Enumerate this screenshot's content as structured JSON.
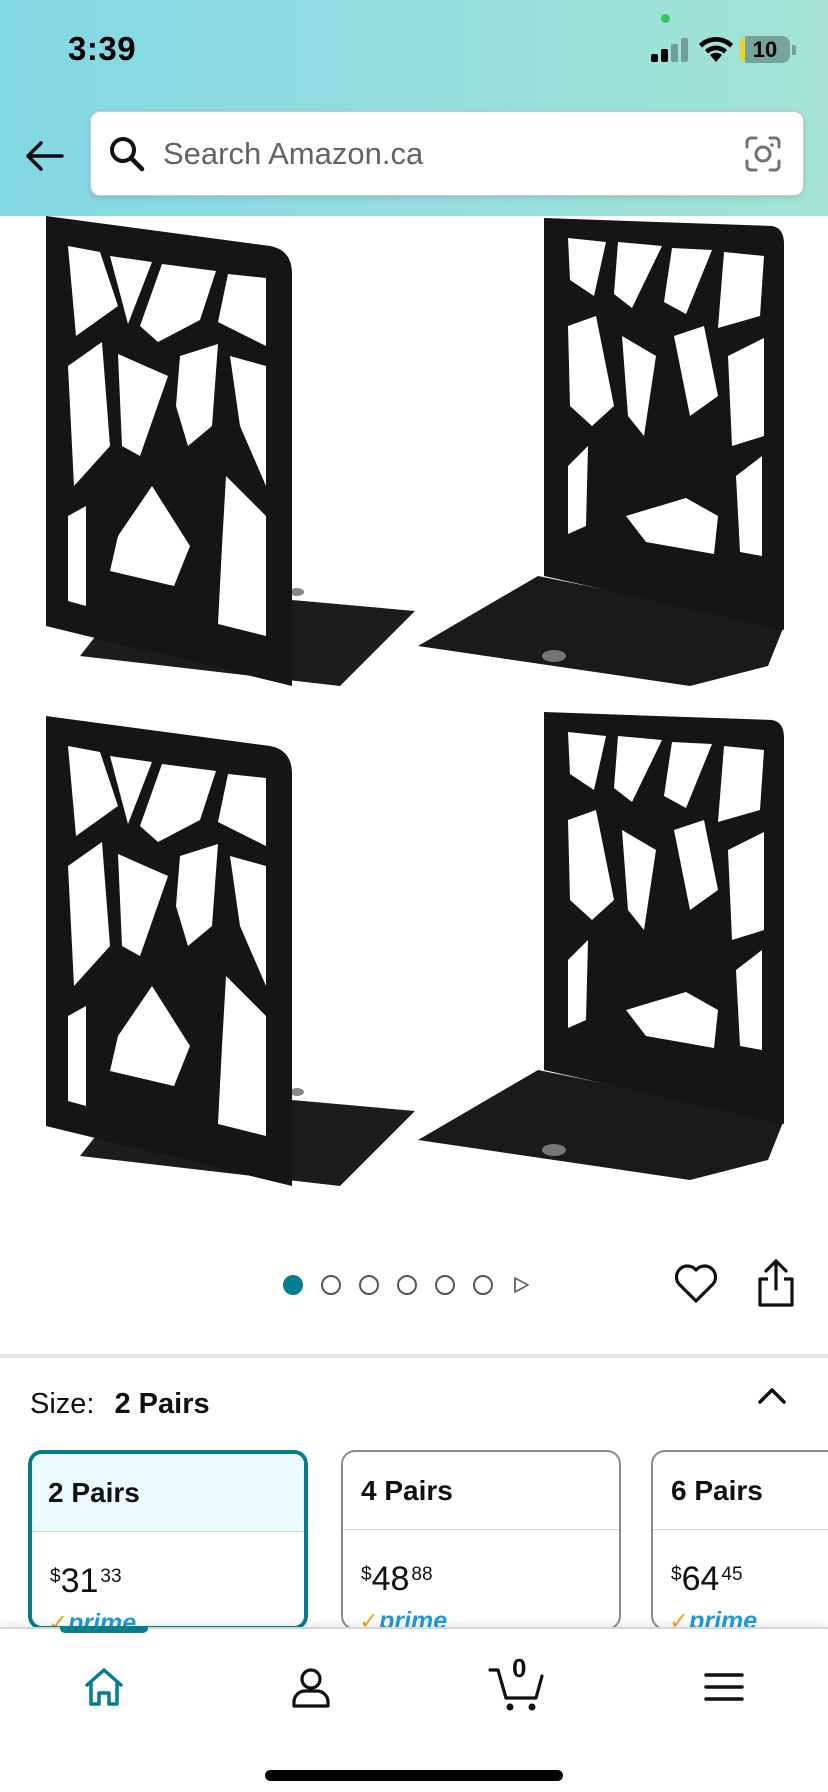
{
  "status_bar": {
    "time": "3:39",
    "battery": "10",
    "battery_level": 0.1
  },
  "search": {
    "placeholder": "Search Amazon.ca"
  },
  "gallery": {
    "image_count": 6,
    "current_index": 1,
    "icons": [
      "back-arrow-icon",
      "search-icon",
      "camera-lens-icon",
      "heart-icon",
      "share-icon",
      "play-next-icon"
    ]
  },
  "size": {
    "label": "Size:",
    "selected": "2 Pairs",
    "options": [
      {
        "name": "2 Pairs",
        "currency": "$",
        "whole": "31",
        "fraction": "33",
        "prime": "prime",
        "selected": true
      },
      {
        "name": "4 Pairs",
        "currency": "$",
        "whole": "48",
        "fraction": "88",
        "prime": "prime",
        "selected": false
      },
      {
        "name": "6 Pairs",
        "currency": "$",
        "whole": "64",
        "fraction": "45",
        "prime": "prime",
        "selected": false
      }
    ]
  },
  "bottom_nav": {
    "items": [
      "home-icon",
      "account-icon",
      "cart-icon",
      "menu-icon"
    ],
    "cart_count": "0",
    "active": "home"
  },
  "colors": {
    "accent": "#067d8f",
    "prime_blue": "#1e9be0",
    "prime_check": "#f8a51c",
    "header_start": "#82d8e3",
    "header_end": "#a5e4d4"
  }
}
